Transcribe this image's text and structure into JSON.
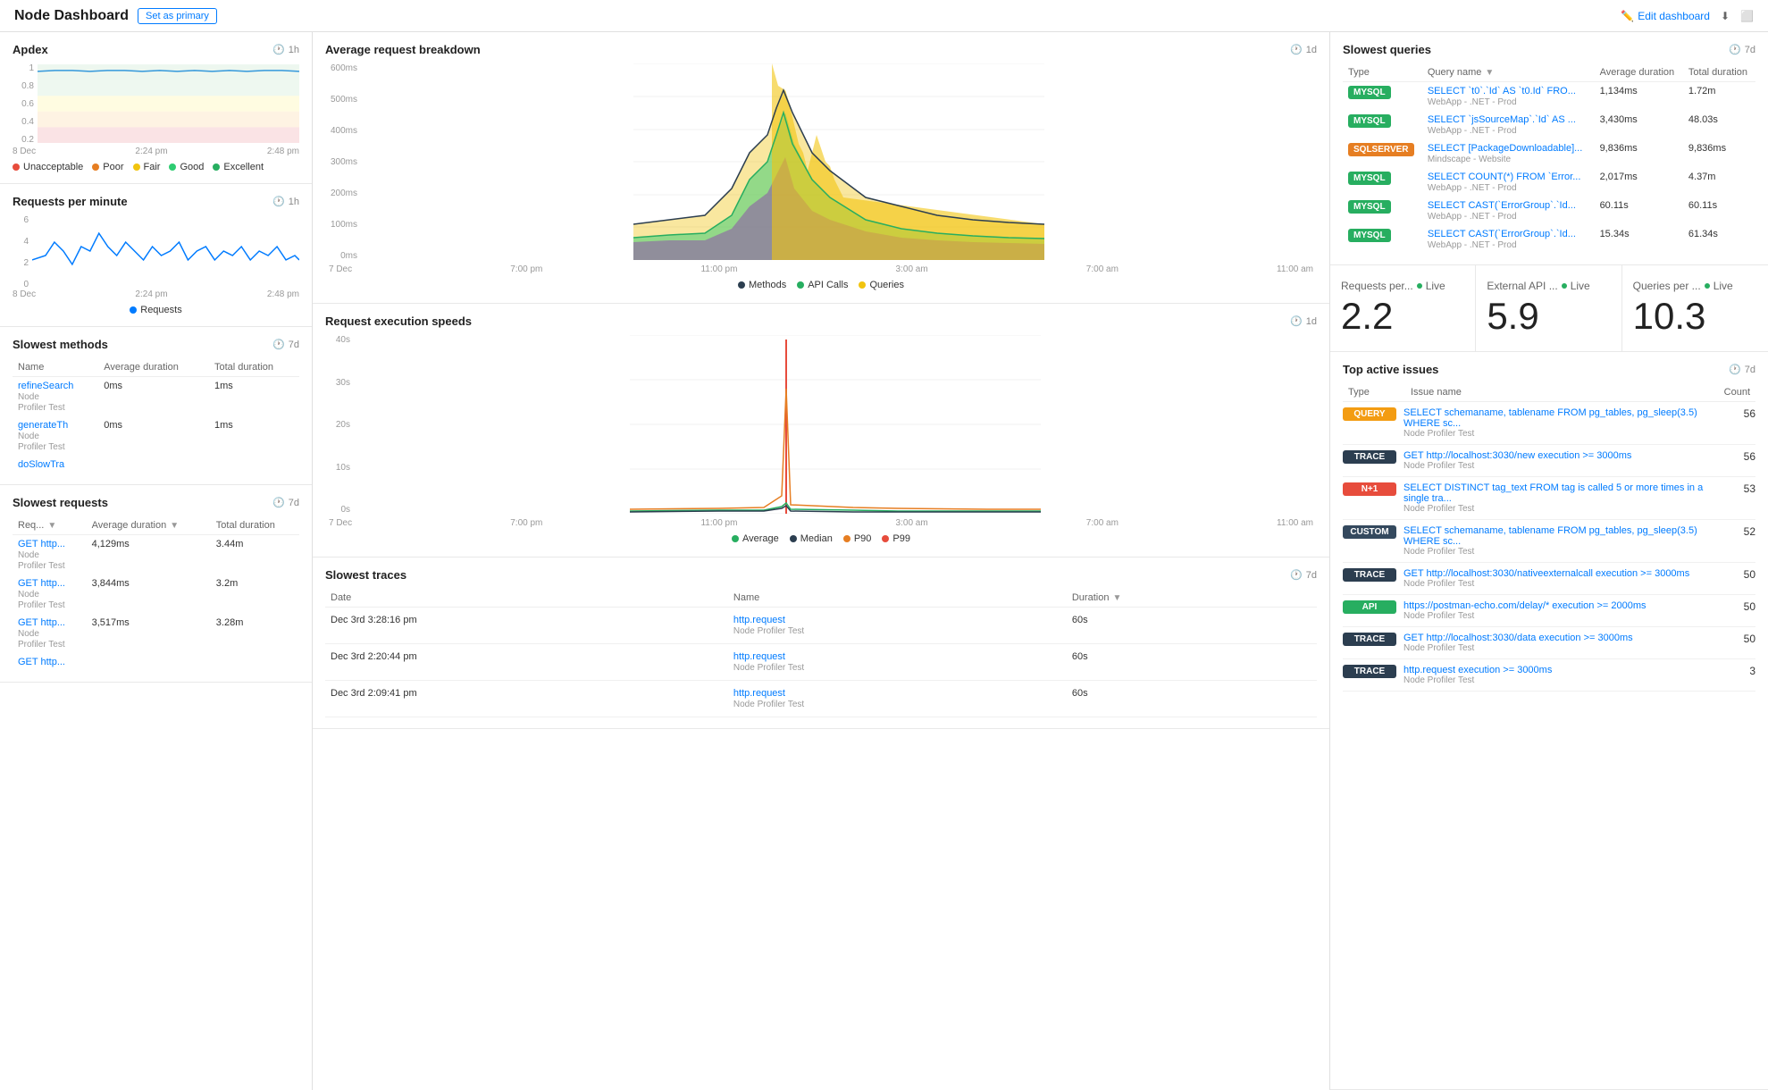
{
  "header": {
    "title": "Node Dashboard",
    "set_primary": "Set as primary",
    "edit_dashboard": "Edit dashboard"
  },
  "apdex": {
    "title": "Apdex",
    "time": "1h",
    "y_labels": [
      "1",
      "0.8",
      "0.6",
      "0.4",
      "0.2"
    ],
    "x_labels": [
      "8 Dec",
      "2:24 pm",
      "2:48 pm"
    ],
    "legend": [
      {
        "label": "Unacceptable",
        "color": "#e74c3c"
      },
      {
        "label": "Poor",
        "color": "#e67e22"
      },
      {
        "label": "Fair",
        "color": "#f1c40f"
      },
      {
        "label": "Good",
        "color": "#2ecc71"
      },
      {
        "label": "Excellent",
        "color": "#27ae60"
      }
    ]
  },
  "rpm": {
    "title": "Requests per minute",
    "time": "1h",
    "y_labels": [
      "6",
      "4",
      "2",
      "0"
    ],
    "x_labels": [
      "8 Dec",
      "2:24 pm",
      "2:48 pm"
    ],
    "legend_label": "Requests",
    "legend_color": "#007bff"
  },
  "slowest_methods": {
    "title": "Slowest methods",
    "time": "7d",
    "columns": [
      "Name",
      "Average duration",
      "Total duration"
    ],
    "rows": [
      {
        "name": "refineSearch",
        "sub": "Node\nProfiler Test",
        "avg": "0ms",
        "total": "1ms"
      },
      {
        "name": "generateTh",
        "sub": "Node\nProfiler Test",
        "avg": "0ms",
        "total": "1ms"
      },
      {
        "name": "doSlowTra",
        "sub": "",
        "avg": "",
        "total": ""
      }
    ]
  },
  "slowest_requests": {
    "title": "Slowest requests",
    "time": "7d",
    "columns": [
      "Req...",
      "Average duration",
      "Total duration"
    ],
    "rows": [
      {
        "name": "GET http...",
        "sub": "Node\nProfiler Test",
        "avg": "4,129ms",
        "total": "3.44m"
      },
      {
        "name": "GET http...",
        "sub": "Node\nProfiler Test",
        "avg": "3,844ms",
        "total": "3.2m"
      },
      {
        "name": "GET http...",
        "sub": "Node\nProfiler Test",
        "avg": "3,517ms",
        "total": "3.28m"
      },
      {
        "name": "GET http...",
        "sub": "",
        "avg": "",
        "total": ""
      }
    ]
  },
  "avg_request_breakdown": {
    "title": "Average request breakdown",
    "time": "1d",
    "y_labels": [
      "600ms",
      "500ms",
      "400ms",
      "300ms",
      "200ms",
      "100ms",
      "0ms"
    ],
    "x_labels": [
      "7 Dec",
      "7:00 pm",
      "11:00 pm",
      "3:00 am",
      "7:00 am",
      "11:00 am"
    ],
    "legend": [
      {
        "label": "Methods",
        "color": "#2c3e50"
      },
      {
        "label": "API Calls",
        "color": "#27ae60"
      },
      {
        "label": "Queries",
        "color": "#f1c40f"
      }
    ]
  },
  "request_execution": {
    "title": "Request execution speeds",
    "time": "1d",
    "y_labels": [
      "40s",
      "30s",
      "20s",
      "10s",
      "0s"
    ],
    "x_labels": [
      "7 Dec",
      "7:00 pm",
      "11:00 pm",
      "3:00 am",
      "7:00 am",
      "11:00 am"
    ],
    "legend": [
      {
        "label": "Average",
        "color": "#27ae60"
      },
      {
        "label": "Median",
        "color": "#2c3e50"
      },
      {
        "label": "P90",
        "color": "#e67e22"
      },
      {
        "label": "P99",
        "color": "#e74c3c"
      }
    ]
  },
  "slowest_traces": {
    "title": "Slowest traces",
    "time": "7d",
    "columns": [
      "Date",
      "Name",
      "Duration"
    ],
    "rows": [
      {
        "date": "Dec 3rd 3:28:16 pm",
        "name": "http.request",
        "sub": "Node Profiler Test",
        "duration": "60s"
      },
      {
        "date": "Dec 3rd 2:20:44 pm",
        "name": "http.request",
        "sub": "Node Profiler Test",
        "duration": "60s"
      },
      {
        "date": "Dec 3rd 2:09:41 pm",
        "name": "http.request",
        "sub": "Node Profiler Test",
        "duration": "60s"
      }
    ]
  },
  "slowest_queries": {
    "title": "Slowest queries",
    "time": "7d",
    "columns": [
      "Type",
      "Query name",
      "Average duration",
      "Total duration"
    ],
    "rows": [
      {
        "type": "MYSQL",
        "type_class": "badge-mysql",
        "name": "SELECT `t0`.`Id` AS `t0.Id` FRO...",
        "sub": "WebApp - .NET - Prod",
        "avg": "1,134ms",
        "total": "1.72m"
      },
      {
        "type": "MYSQL",
        "type_class": "badge-mysql",
        "name": "SELECT `jsSourceMap`.`Id` AS ...",
        "sub": "WebApp - .NET - Prod",
        "avg": "3,430ms",
        "total": "48.03s"
      },
      {
        "type": "SQLSERVER",
        "type_class": "badge-sqlserver",
        "name": "SELECT [PackageDownloadable]...",
        "sub": "Mindscape - Website",
        "avg": "9,836ms",
        "total": "9,836ms"
      },
      {
        "type": "MYSQL",
        "type_class": "badge-mysql",
        "name": "SELECT COUNT(*) FROM `Error...",
        "sub": "WebApp - .NET - Prod",
        "avg": "2,017ms",
        "total": "4.37m"
      },
      {
        "type": "MYSQL",
        "type_class": "badge-mysql",
        "name": "SELECT CAST(`ErrorGroup`.`Id...",
        "sub": "WebApp - .NET - Prod",
        "avg": "60.11s",
        "total": "60.11s"
      },
      {
        "type": "MYSQL",
        "type_class": "badge-mysql",
        "name": "SELECT CAST(`ErrorGroup`.`Id...",
        "sub": "WebApp - .NET - Prod",
        "avg": "15.34s",
        "total": "61.34s"
      }
    ]
  },
  "metrics": {
    "requests_per": {
      "title": "Requests per...",
      "value": "2.2"
    },
    "external_api": {
      "title": "External API ...",
      "value": "5.9"
    },
    "queries_per": {
      "title": "Queries per ...",
      "value": "10.3"
    },
    "live_label": "Live"
  },
  "top_active_issues": {
    "title": "Top active issues",
    "time": "7d",
    "columns": [
      "Type",
      "Issue name",
      "Count"
    ],
    "rows": [
      {
        "type": "QUERY",
        "type_class": "badge-query",
        "name": "SELECT schemaname, tablename FROM pg_tables, pg_sleep(3.5) WHERE sc...",
        "sub": "Node Profiler Test",
        "count": "56"
      },
      {
        "type": "TRACE",
        "type_class": "badge-trace",
        "name": "GET http://localhost:3030/new execution >= 3000ms",
        "sub": "Node Profiler Test",
        "count": "56"
      },
      {
        "type": "N+1",
        "type_class": "badge-n1",
        "name": "SELECT DISTINCT tag_text FROM tag is called 5 or more times in a single tra...",
        "sub": "Node Profiler Test",
        "count": "53"
      },
      {
        "type": "CUSTOM",
        "type_class": "badge-custom",
        "name": "SELECT schemaname, tablename FROM pg_tables, pg_sleep(3.5) WHERE sc...",
        "sub": "Node Profiler Test",
        "count": "52"
      },
      {
        "type": "TRACE",
        "type_class": "badge-trace",
        "name": "GET http://localhost:3030/nativeexternalcall execution >= 3000ms",
        "sub": "Node Profiler Test",
        "count": "50"
      },
      {
        "type": "API",
        "type_class": "badge-api",
        "name": "https://postman-echo.com/delay/* execution >= 2000ms",
        "sub": "Node Profiler Test",
        "count": "50"
      },
      {
        "type": "TRACE",
        "type_class": "badge-trace",
        "name": "GET http://localhost:3030/data execution >= 3000ms",
        "sub": "Node Profiler Test",
        "count": "50"
      },
      {
        "type": "TRACE",
        "type_class": "badge-trace",
        "name": "http.request execution >= 3000ms",
        "sub": "Node Profiler Test",
        "count": "3"
      }
    ]
  }
}
